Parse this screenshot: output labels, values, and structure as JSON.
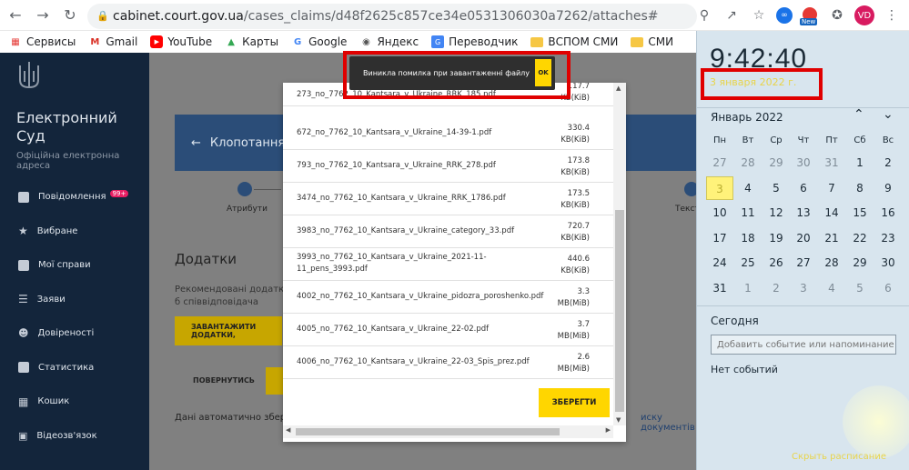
{
  "browser": {
    "url_domain": "cabinet.court.gov.ua",
    "url_path": "/cases_claims/d48f2625c857ce34e0531306030a7262/attaches#",
    "avatar": "VD",
    "new_badge": "New",
    "bookmarks": [
      {
        "label": "Сервисы",
        "icon": "apps-grid-icon"
      },
      {
        "label": "Gmail",
        "icon": "gmail-icon"
      },
      {
        "label": "YouTube",
        "icon": "youtube-icon"
      },
      {
        "label": "Карты",
        "icon": "maps-icon"
      },
      {
        "label": "Google",
        "icon": "google-icon"
      },
      {
        "label": "Яндекс",
        "icon": "yandex-icon"
      },
      {
        "label": "Переводчик",
        "icon": "translate-icon"
      },
      {
        "label": "ВСПОМ СМИ",
        "icon": "folder-icon"
      },
      {
        "label": "СМИ",
        "icon": "folder-icon"
      }
    ]
  },
  "sidebar": {
    "brand": "Електронний Суд",
    "subtitle": "Офіційна електронна адреса",
    "items": [
      {
        "label": "Повідомлення",
        "badge": "99+",
        "icon": "message-icon"
      },
      {
        "label": "Вибране",
        "icon": "star-icon"
      },
      {
        "label": "Мої справи",
        "icon": "folder-icon"
      },
      {
        "label": "Заяви",
        "icon": "list-icon"
      },
      {
        "label": "Довіреності",
        "icon": "people-icon"
      },
      {
        "label": "Статистика",
        "icon": "chart-icon"
      },
      {
        "label": "Кошик",
        "icon": "trash-icon"
      },
      {
        "label": "Відеозв'язок",
        "icon": "video-icon"
      }
    ]
  },
  "main": {
    "header_title": "Клопотання про",
    "step1_label": "Атрибути",
    "step2_label": "Текст",
    "section_title": "Додатки",
    "recommended_text": "Рекомендовані додатки: б співвідповідача",
    "upload_button": "ЗАВАНТАЖИТИ ДОДАТКИ,",
    "back_button": "ПОВЕРНУТИСЬ",
    "auto_text": "Дані автоматично збереж",
    "docs_link": "иску документів"
  },
  "modal": {
    "files": [
      {
        "name": "273_no_7762_10_Kantsara_v_Ukraine_RRK_185.pdf",
        "size_value": "117.7",
        "size_unit": "KB(KiB)"
      },
      {
        "name": "672_no_7762_10_Kantsara_v_Ukraine_14-39-1.pdf",
        "size_value": "330.4",
        "size_unit": "KB(KiB)"
      },
      {
        "name": "793_no_7762_10_Kantsara_v_Ukraine_RRK_278.pdf",
        "size_value": "173.8",
        "size_unit": "KB(KiB)"
      },
      {
        "name": "3474_no_7762_10_Kantsara_v_Ukraine_RRK_1786.pdf",
        "size_value": "173.5",
        "size_unit": "KB(KiB)"
      },
      {
        "name": "3983_no_7762_10_Kantsara_v_Ukraine_category_33.pdf",
        "size_value": "720.7",
        "size_unit": "KB(KiB)"
      },
      {
        "name": "3993_no_7762_10_Kantsara_v_Ukraine_2021-11-11_pens_3993.pdf",
        "size_value": "440.6",
        "size_unit": "KB(KiB)"
      },
      {
        "name": "4002_no_7762_10_Kantsara_v_Ukraine_pidozra_poroshenko.pdf",
        "size_value": "3.3",
        "size_unit": "MB(MiB)"
      },
      {
        "name": "4005_no_7762_10_Kantsara_v_Ukraine_22-02.pdf",
        "size_value": "3.7",
        "size_unit": "MB(MiB)"
      },
      {
        "name": "4006_no_7762_10_Kantsara_v_Ukraine_22-03_Spis_prez.pdf",
        "size_value": "2.6",
        "size_unit": "MB(MiB)"
      }
    ],
    "save_button": "ЗБЕРЕГТИ"
  },
  "toast": {
    "message": "Виникла помилка при завантаженні файлу",
    "ok": "OK"
  },
  "calendar": {
    "time": "9:42:40",
    "date": "3 января 2022 г.",
    "month": "Январь 2022",
    "weekdays": [
      "Пн",
      "Вт",
      "Ср",
      "Чт",
      "Пт",
      "Сб",
      "Вс"
    ],
    "weeks": [
      [
        "27",
        "28",
        "29",
        "30",
        "31",
        "1",
        "2"
      ],
      [
        "3",
        "4",
        "5",
        "6",
        "7",
        "8",
        "9"
      ],
      [
        "10",
        "11",
        "12",
        "13",
        "14",
        "15",
        "16"
      ],
      [
        "17",
        "18",
        "19",
        "20",
        "21",
        "22",
        "23"
      ],
      [
        "24",
        "25",
        "26",
        "27",
        "28",
        "29",
        "30"
      ],
      [
        "31",
        "1",
        "2",
        "3",
        "4",
        "5",
        "6"
      ]
    ],
    "today_label": "Сегодня",
    "add_event_placeholder": "Добавить событие или напоминание",
    "no_events": "Нет событий",
    "hide_calendar": "Скрыть расписание"
  },
  "colors": {
    "sidebar_bg": "#13253b",
    "accent_yellow": "#ffd600",
    "highlight_red": "#e00000",
    "header_blue": "#2b4d78"
  }
}
